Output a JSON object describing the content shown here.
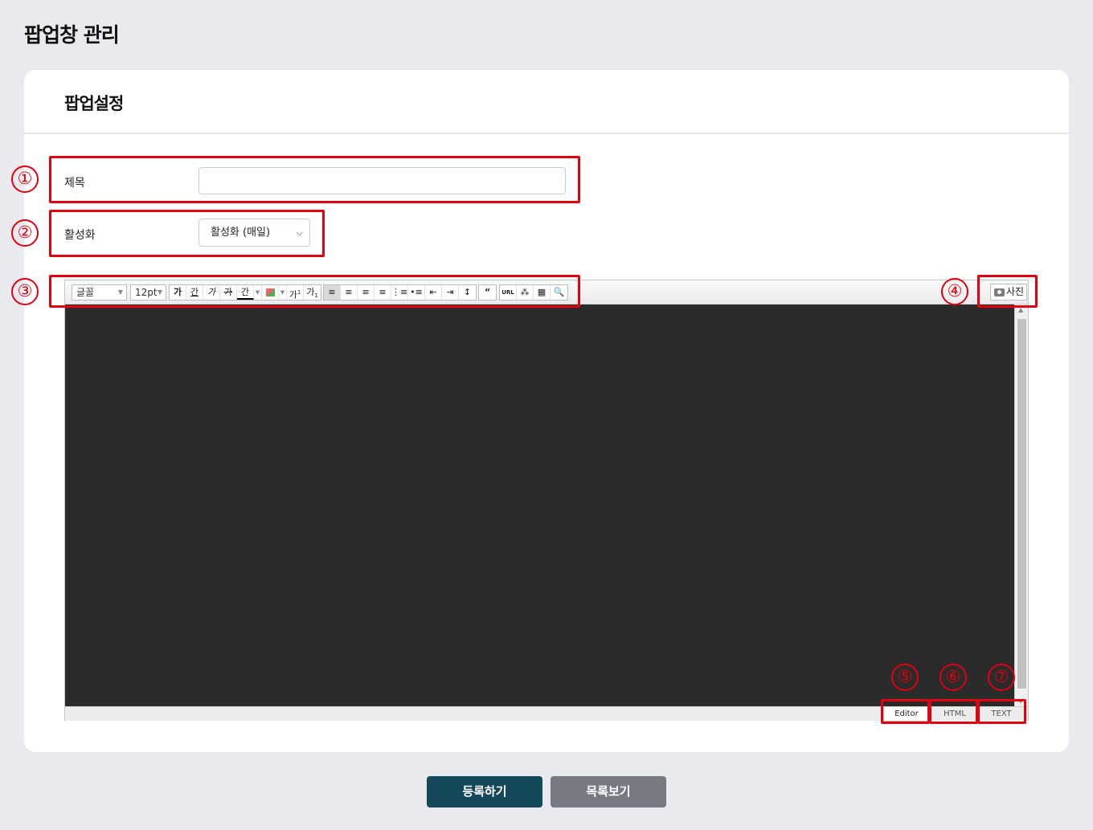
{
  "page": {
    "title": "팝업창 관리"
  },
  "card": {
    "title": "팝업설정"
  },
  "form": {
    "title_label": "제목",
    "title_value": "",
    "activation_label": "활성화",
    "activation_selected": "활성화 (매일)"
  },
  "editor": {
    "toolbar": {
      "font_family": "글꼴",
      "font_size": "12pt",
      "format_buttons": [
        "가",
        "간",
        "가",
        "가",
        "간"
      ],
      "superscript": "가",
      "subscript": "가",
      "photo_button": "사진"
    },
    "modes": [
      "Editor",
      "HTML",
      "TEXT"
    ],
    "active_mode": "Editor"
  },
  "annotations": [
    "①",
    "②",
    "③",
    "④",
    "⑤",
    "⑥",
    "⑦"
  ],
  "actions": {
    "submit": "등록하기",
    "list": "목록보기"
  },
  "colors": {
    "accent": "#15485a",
    "secondary": "#767b83",
    "highlight": "#e0000f"
  }
}
